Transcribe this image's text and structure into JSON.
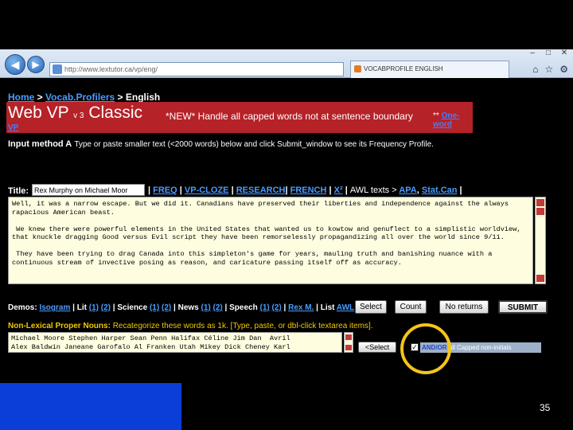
{
  "browser": {
    "address": "http://www.lextutor.ca/vp/eng/",
    "addr_buttons": "⌄ ↻ ✕",
    "tab_title": "VOCABPROFILE ENGLISH"
  },
  "breadcrumb": {
    "home": "Home",
    "sep1": " > ",
    "vocabprofilers": "Vocab.Profilers",
    "sep2": " > ",
    "current": "English"
  },
  "banner": {
    "title": "Web VP",
    "version": "v 3",
    "subtitle": "Classic",
    "new_notice": "*NEW* Handle all capped words not at sentence boundary",
    "link_prefix": "**",
    "link_label": "One-word",
    "vp_label": "VP"
  },
  "input_method": {
    "label": "Input method A",
    "text": "Type or paste smaller text (<2000 words) below and click Submit_window to see its Frequency Profile."
  },
  "title_row": {
    "label": "Title:",
    "value": "Rex Murphy on Michael Moor",
    "links": [
      "FREQ",
      "VP-CLOZE",
      "RESEARCH",
      "FRENCH",
      "X²"
    ],
    "awl_text": "AWL texts >",
    "awl_links": [
      "APA",
      "Stat.Can"
    ]
  },
  "main_text": "Well, it was a narrow escape. But we did it. Canadians have preserved their liberties and independence against the always rapacious American beast.\n\n We knew there were powerful elements in the United States that wanted us to kowtow and genuflect to a simplistic worldview, that knuckle dragging Good versus Evil script they have been remorselessly propagandizing all over the world since 9/11.\n\n They have been trying to drag Canada into this simpleton's game for years, mauling truth and banishing nuance with a continuous stream of invective posing as reason, and caricature passing itself off as accuracy.",
  "demos": {
    "label": "Demos:",
    "isogram": "Isogram",
    "lit": "Lit",
    "science": "Science",
    "news": "News",
    "speech": "Speech",
    "rexm": "Rex M.",
    "list": "List",
    "awl": "AWL",
    "n1": "(1)",
    "n2": "(2)",
    "sep": " | "
  },
  "buttons": {
    "select": "Select",
    "count": "Count",
    "no_returns": "No returns",
    "submit": "SUBMIT",
    "select2": "<Select"
  },
  "nonlex": {
    "label": "Non-Lexical Proper Nouns:",
    "instruction": "Recategorize these words as 1k. [Type, paste, or dbl-click textarea items].",
    "text": "Michael Moore Stephen Harper Sean Penn Halifax Céline Jim Dan  Avril\nAlex Baldwin Janeane Garofalo Al Franken Utah Mikey Dick Cheney Karl"
  },
  "andor": {
    "check": "✓",
    "label": "AND/OR",
    "rest": "all Capped non-initials"
  },
  "slide_number": "35",
  "colors": {
    "banner": "#b52227",
    "link": "#4a9cff",
    "highlight": "#f5c518",
    "slide_blue": "#0b3ed6"
  }
}
